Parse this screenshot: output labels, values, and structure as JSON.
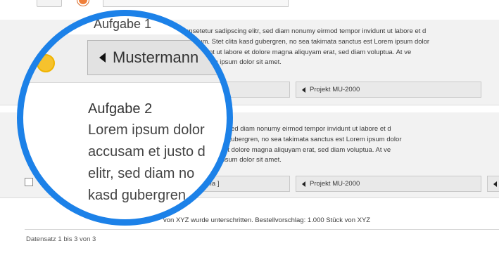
{
  "rows": [
    {
      "text_lines": [
        "amet, consetetur sadipscing elitr, sed diam nonumy eirmod tempor invidunt ut labore et d",
        "es et ea rebum. Stet clita kasd gubergren, no sea takimata sanctus est Lorem ipsum dolor",
        "d tempor invidunt ut labore et dolore magna aliquyam erat, sed diam voluptua. At ve",
        "sanctus est Lorem ipsum dolor sit amet."
      ],
      "project": "Projekt MU-2000"
    },
    {
      "text_lines": [
        "setur sadipscing elitr, sed diam nonumy eirmod tempor invidunt ut labore et d",
        "ebum. Stet clita kasd gubergren, no sea takimata sanctus est Lorem ipsum dolor",
        "or invidunt ut labore et dolore magna aliquyam erat, sed diam voluptua. At ve",
        "sanctus est Lorem ipsum dolor sit amet."
      ],
      "assignee_partial": "Ma ]",
      "project": "Projekt MU-2000"
    }
  ],
  "note": "von XYZ wurde unterschritten. Bestellvorschlag: 1.000 Stück von XYZ",
  "footer": {
    "record_info": "Datensatz 1 bis 3 von 3"
  },
  "magnifier": {
    "partial_heading": "Aufgabe 1",
    "assignee": "Mustermann",
    "title": "Aufgabe 2",
    "body": "Lorem ipsum dolor\naccusam et justo d\nelitr, sed diam no\nkasd gubergren"
  },
  "colors": {
    "magnifier_ring": "#1c81e8",
    "status_dot_yellow": "#f6c22d",
    "status_dot_orange": "#ef7f3a"
  }
}
